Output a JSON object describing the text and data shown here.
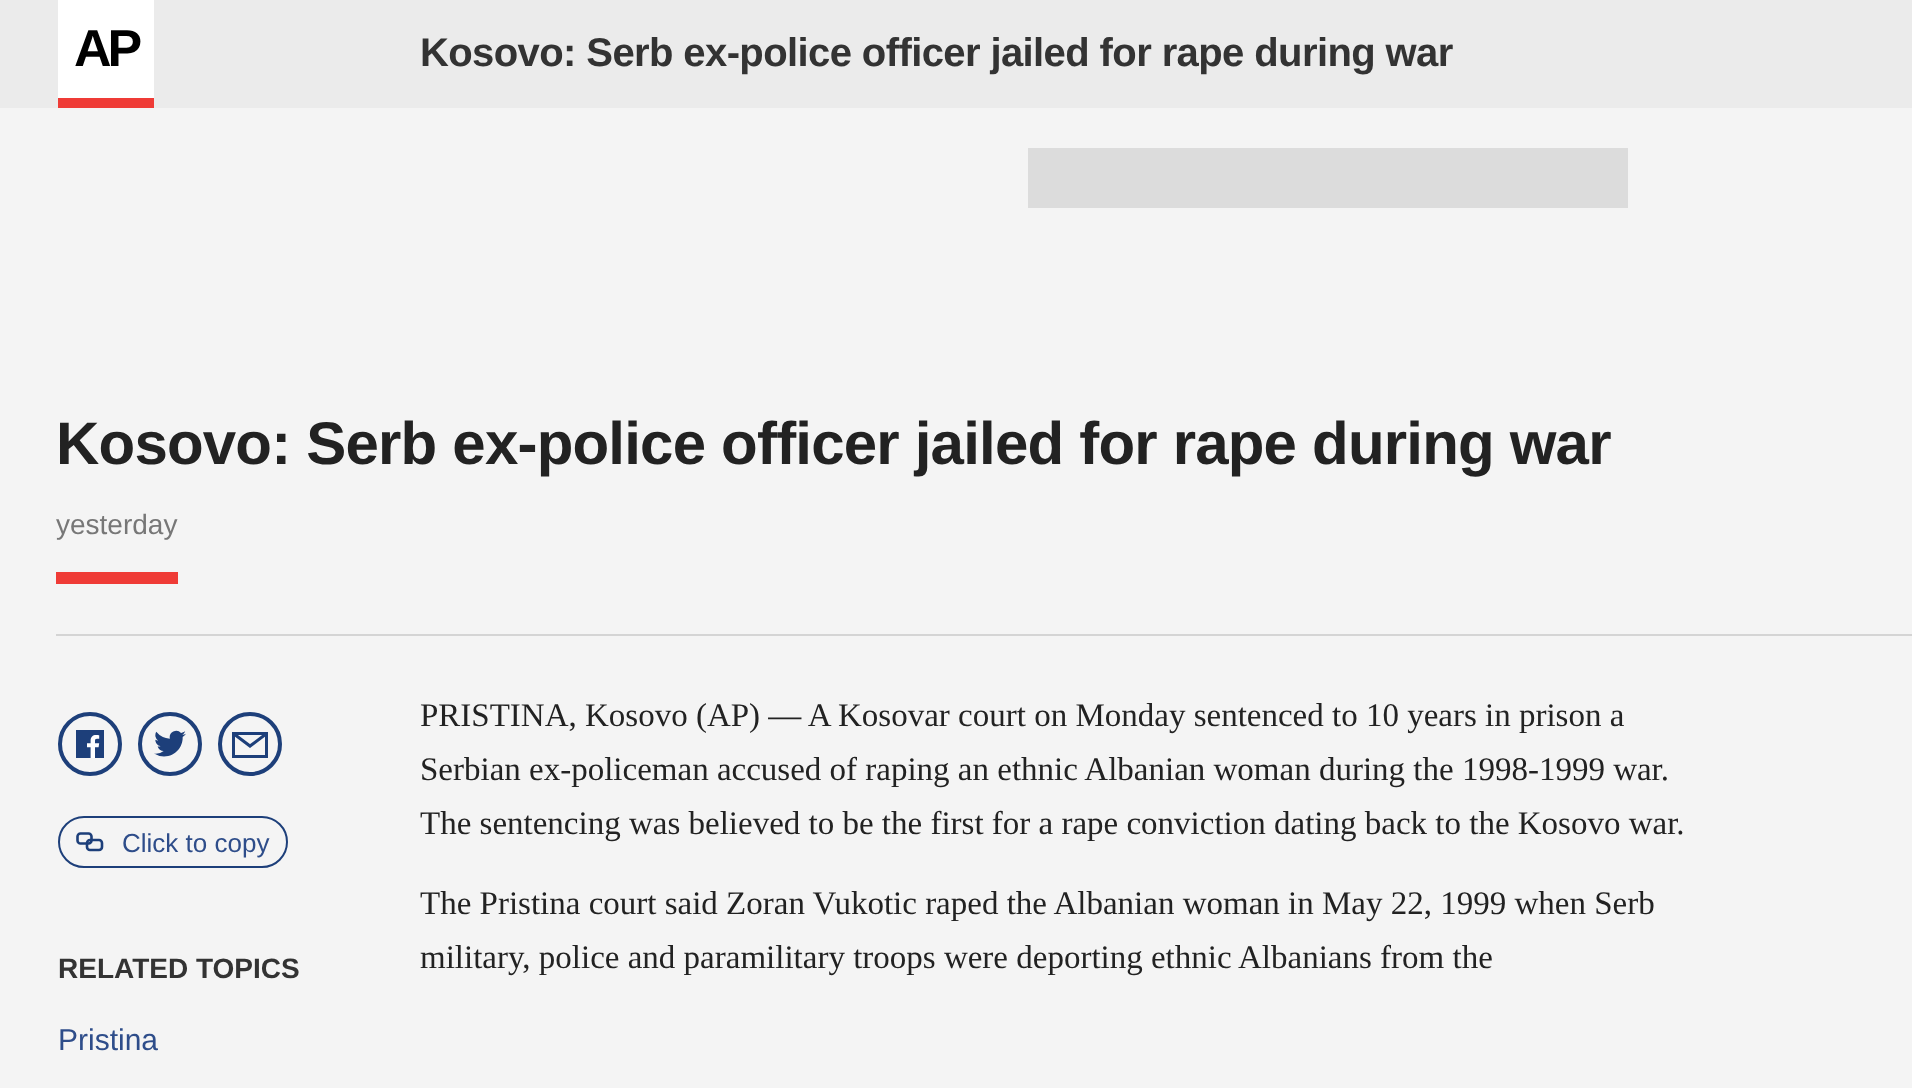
{
  "header": {
    "logo": "AP",
    "title": "Kosovo: Serb ex-police officer jailed for rape during war"
  },
  "article": {
    "headline": "Kosovo: Serb ex-police officer jailed for rape during war",
    "date": "yesterday",
    "share": {
      "copy_label": "Click to copy"
    },
    "related_topics": {
      "heading": "RELATED TOPICS",
      "items": [
        "Pristina"
      ]
    },
    "paragraphs": [
      "PRISTINA, Kosovo (AP) — A Kosovar court on Monday sentenced to 10 years in prison a Serbian ex-policeman accused of raping an ethnic Albanian woman during the 1998-1999 war. The sentencing was believed to be the first for a rape conviction dating back to the Kosovo war.",
      "The Pristina court said Zoran Vukotic raped the Albanian woman in May 22, 1999 when Serb military, police and paramilitary troops were deporting ethnic Albanians from the"
    ]
  }
}
